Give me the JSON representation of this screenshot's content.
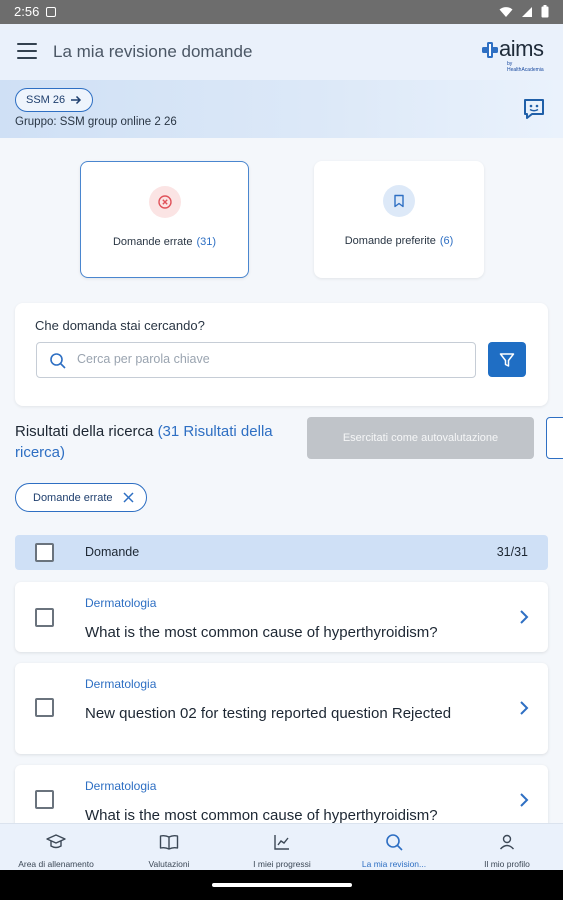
{
  "status_bar": {
    "time": "2:56"
  },
  "app_bar": {
    "title": "La mia revisione domande",
    "logo_text": "aims",
    "logo_sub": "by HealthAcademia"
  },
  "group": {
    "course_pill": "SSM 26",
    "group_text": "Gruppo: SSM group online 2 26"
  },
  "cards": [
    {
      "label": "Domande errate",
      "count": "(31)",
      "icon": "error-circle-icon",
      "color": "#e0525a"
    },
    {
      "label": "Domande preferite",
      "count": "(6)",
      "icon": "bookmark-icon",
      "color": "#2e6fc3"
    }
  ],
  "search": {
    "question": "Che domanda stai cercando?",
    "placeholder": "Cerca per parola chiave"
  },
  "results": {
    "label": "Risultati della ricerca",
    "count_text": "(31 Risultati della ricerca)"
  },
  "self_eval_button": "Esercitati come autovalutazione",
  "filter_chip": {
    "label": "Domande errate"
  },
  "table_header": {
    "label": "Domande",
    "count": "31/31"
  },
  "questions": [
    {
      "category": "Dermatologia",
      "text": "What is the most common cause of hyperthyroidism?"
    },
    {
      "category": "Dermatologia",
      "text": "New question 02 for testing reported question Rejected"
    },
    {
      "category": "Dermatologia",
      "text": "What is the most common cause of hyperthyroidism?"
    }
  ],
  "bottom_nav": [
    {
      "label": "Area di allenamento",
      "icon": "graduation-cap-icon"
    },
    {
      "label": "Valutazioni",
      "icon": "open-book-icon"
    },
    {
      "label": "I miei progressi",
      "icon": "chart-icon"
    },
    {
      "label": "La mia revision...",
      "icon": "search-icon",
      "active": true
    },
    {
      "label": "Il mio profilo",
      "icon": "profile-icon"
    }
  ],
  "colors": {
    "accent": "#2e6fc3",
    "error": "#e0525a",
    "disabled": "#c0c4c9"
  }
}
